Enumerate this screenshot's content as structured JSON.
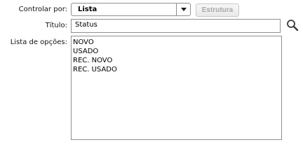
{
  "form": {
    "controlar_por": {
      "label": "Controlar por:",
      "value": "Lista"
    },
    "estrutura_button": "Estrutura",
    "titulo": {
      "label": "Título:",
      "value": "Status"
    },
    "lista_opcoes": {
      "label": "Lista de opções:",
      "items": [
        "NOVO",
        "USADO",
        "REC. NOVO",
        "REC. USADO"
      ]
    }
  },
  "icons": {
    "search": "search-icon",
    "dropdown": "chevron-down-icon"
  },
  "colors": {
    "border": "#8e8f8f",
    "disabled_text": "#a8a8a8"
  }
}
